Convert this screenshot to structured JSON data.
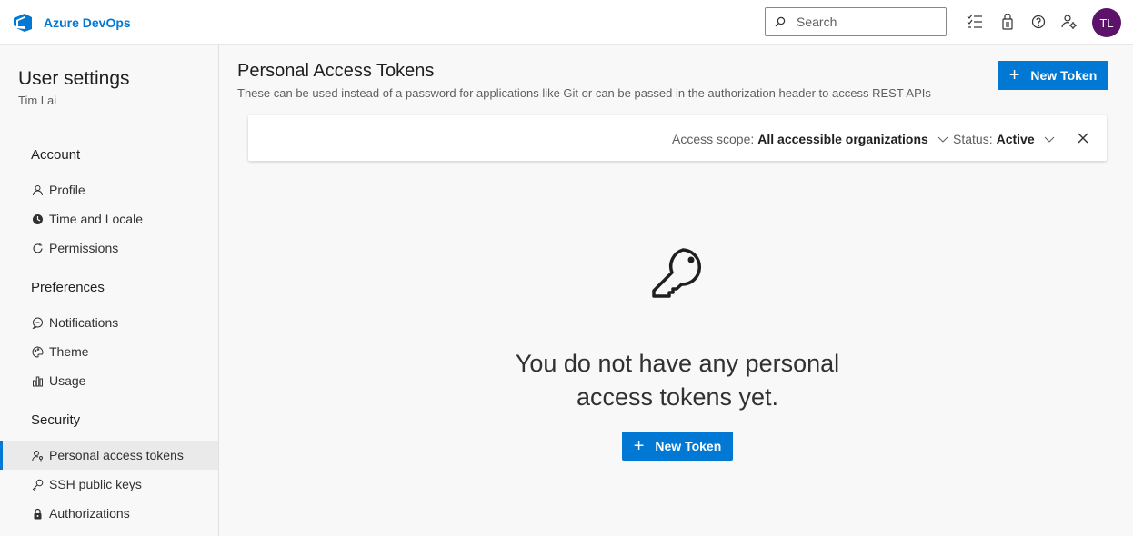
{
  "app": {
    "name": "Azure DevOps"
  },
  "search": {
    "placeholder": "Search"
  },
  "topbar": {
    "icons": [
      "work-items-icon",
      "marketplace-icon",
      "help-icon",
      "user-settings-icon"
    ],
    "avatar_initials": "TL",
    "avatar_color": "#5c126b"
  },
  "sidebar": {
    "title": "User settings",
    "user": "Tim Lai",
    "sections": [
      {
        "label": "Account",
        "items": [
          {
            "label": "Profile",
            "icon": "profile-icon"
          },
          {
            "label": "Time and Locale",
            "icon": "globe-icon"
          },
          {
            "label": "Permissions",
            "icon": "refresh-icon"
          }
        ]
      },
      {
        "label": "Preferences",
        "items": [
          {
            "label": "Notifications",
            "icon": "chat-icon"
          },
          {
            "label": "Theme",
            "icon": "palette-icon"
          },
          {
            "label": "Usage",
            "icon": "chart-icon"
          }
        ]
      },
      {
        "label": "Security",
        "items": [
          {
            "label": "Personal access tokens",
            "icon": "user-key-icon",
            "active": true
          },
          {
            "label": "SSH public keys",
            "icon": "key-icon"
          },
          {
            "label": "Authorizations",
            "icon": "lock-icon"
          }
        ]
      }
    ]
  },
  "main": {
    "title": "Personal Access Tokens",
    "subtitle": "These can be used instead of a password for applications like Git or can be passed in the authorization header to access REST APIs",
    "new_token_label": "New Token",
    "filters": {
      "scope_label": "Access scope:",
      "scope_value": "All accessible organizations",
      "status_label": "Status:",
      "status_value": "Active"
    },
    "empty": {
      "line1": "You do not have any personal",
      "line2": "access tokens yet.",
      "button_label": "New Token"
    }
  },
  "colors": {
    "accent": "#0078d4",
    "active_nav_bg": "#eaeaea"
  }
}
